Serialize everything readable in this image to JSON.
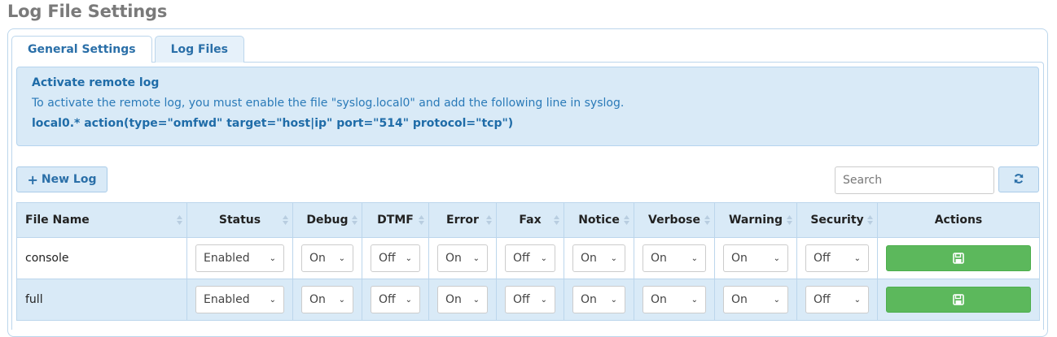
{
  "page": {
    "title": "Log File Settings"
  },
  "tabs": [
    {
      "label": "General Settings",
      "active": false
    },
    {
      "label": "Log Files",
      "active": true
    }
  ],
  "alert": {
    "title": "Activate remote log",
    "text": "To activate the remote log, you must enable the file \"syslog.local0\" and add the following line in syslog.",
    "code": "local0.* action(type=\"omfwd\" target=\"host|ip\" port=\"514\" protocol=\"tcp\")"
  },
  "toolbar": {
    "new_log_label": "New Log",
    "new_log_icon": "plus-icon",
    "search_placeholder": "Search",
    "refresh_icon": "refresh-icon"
  },
  "table": {
    "columns": [
      "File Name",
      "Status",
      "Debug",
      "DTMF",
      "Error",
      "Fax",
      "Notice",
      "Verbose",
      "Warning",
      "Security",
      "Actions"
    ],
    "rows": [
      {
        "name": "console",
        "status": "Enabled",
        "debug": "On",
        "dtmf": "Off",
        "error": "On",
        "fax": "Off",
        "notice": "On",
        "verbose": "On",
        "warning": "On",
        "security": "Off"
      },
      {
        "name": "full",
        "status": "Enabled",
        "debug": "On",
        "dtmf": "Off",
        "error": "On",
        "fax": "Off",
        "notice": "On",
        "verbose": "On",
        "warning": "On",
        "security": "Off"
      }
    ],
    "action_icon": "save-icon"
  },
  "colors": {
    "accent": "#2a6fa8",
    "alert_bg": "#d9eaf7",
    "save_green": "#5cb85c"
  }
}
